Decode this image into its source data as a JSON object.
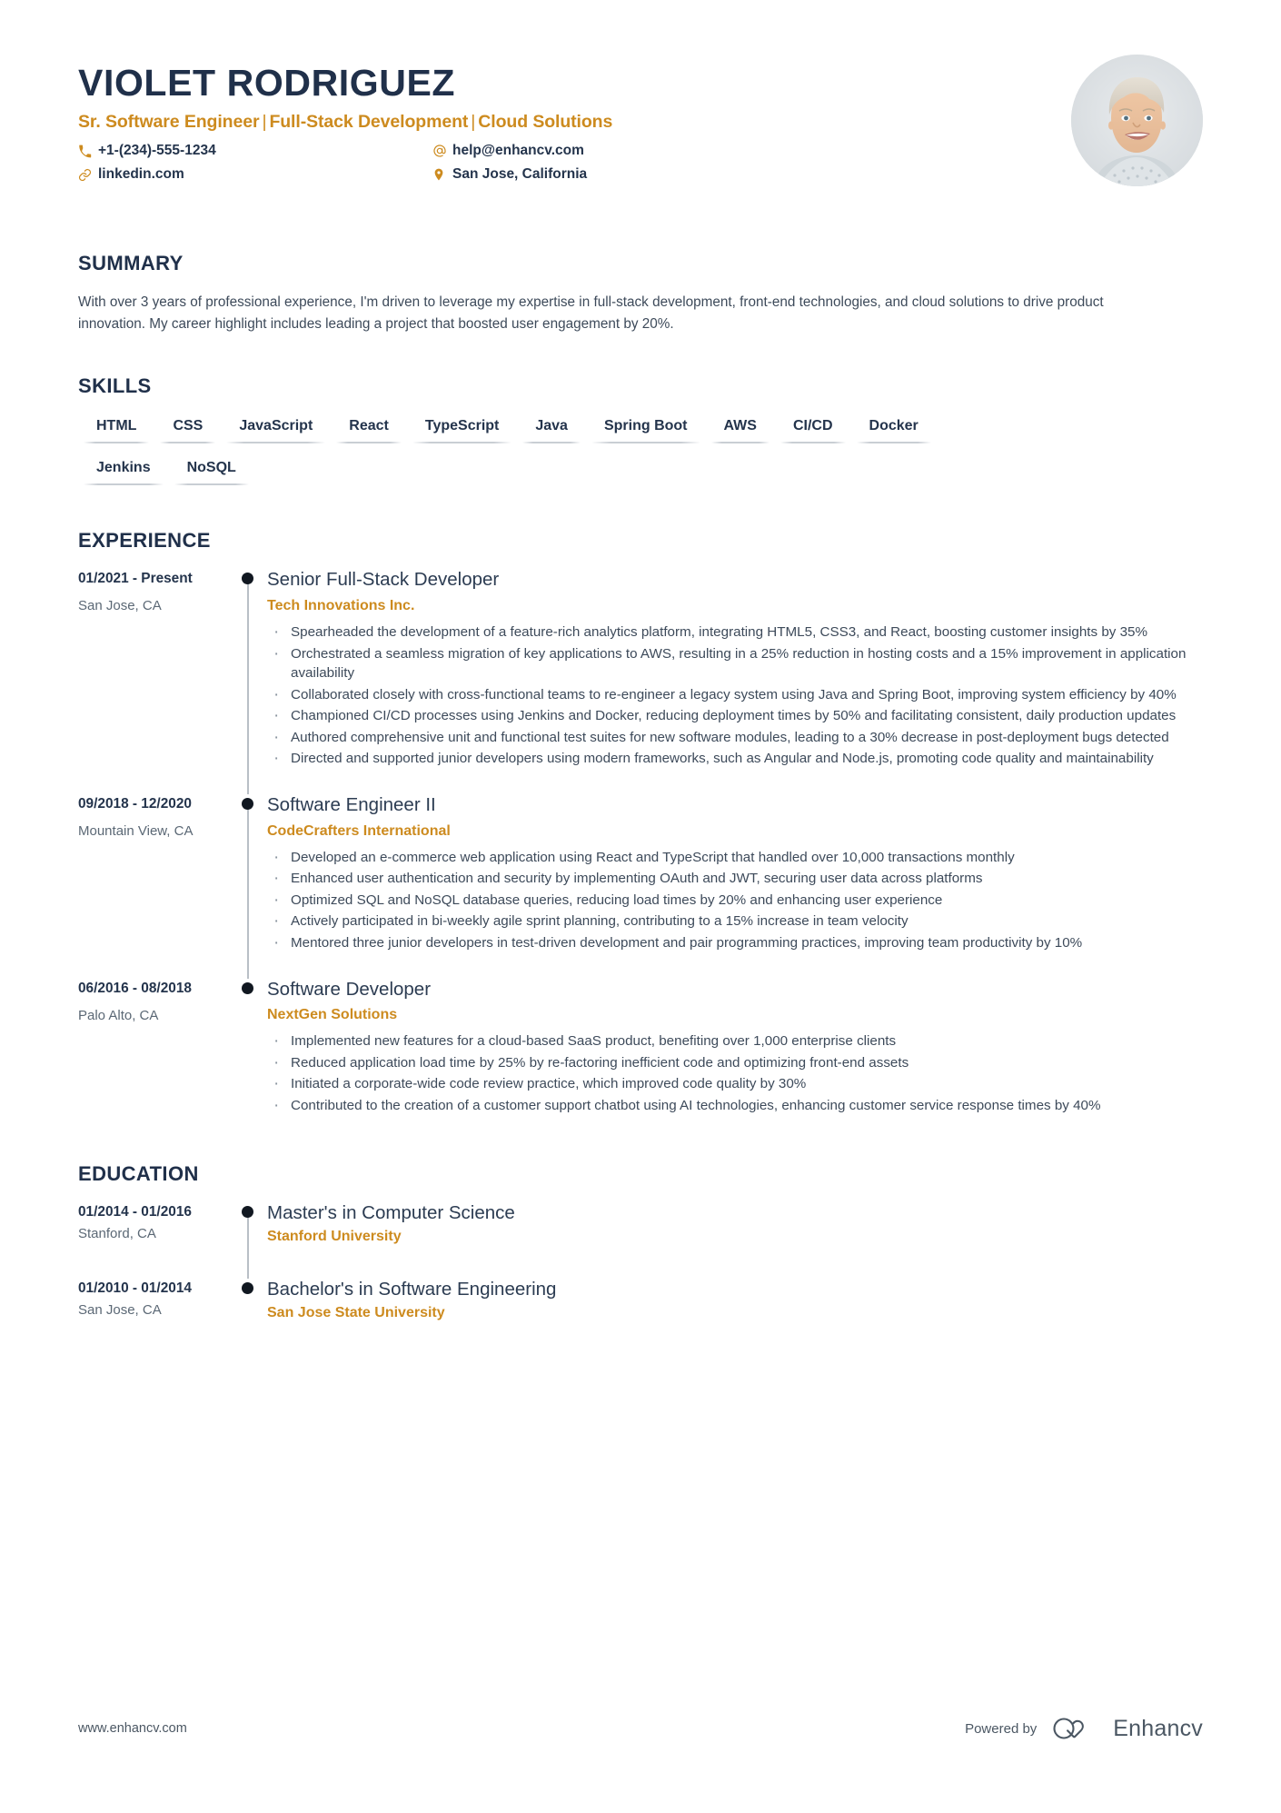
{
  "header": {
    "name": "VIOLET RODRIGUEZ",
    "headline_parts": [
      "Sr. Software Engineer",
      "Full-Stack Development",
      "Cloud Solutions"
    ],
    "headline": "Sr. Software Engineer | Full-Stack Development | Cloud Solutions",
    "contacts": [
      {
        "icon": "phone-icon",
        "value": "+1-(234)-555-1234"
      },
      {
        "icon": "at-icon",
        "value": "help@enhancv.com"
      },
      {
        "icon": "link-icon",
        "value": "linkedin.com"
      },
      {
        "icon": "location-pin-icon",
        "value": "San Jose, California"
      }
    ],
    "photo_alt": "portrait-photo"
  },
  "summary": {
    "title": "SUMMARY",
    "text": "With over 3 years of professional experience, I'm driven to leverage my expertise in full-stack development, front-end technologies, and cloud solutions to drive product innovation. My career highlight includes leading a project that boosted user engagement by 20%."
  },
  "skills": {
    "title": "SKILLS",
    "rows": [
      [
        "HTML",
        "CSS",
        "JavaScript",
        "React",
        "TypeScript",
        "Java",
        "Spring Boot",
        "AWS",
        "CI/CD",
        "Docker"
      ],
      [
        "Jenkins",
        "NoSQL"
      ]
    ]
  },
  "experience": {
    "title": "EXPERIENCE",
    "entries": [
      {
        "date": "01/2021 - Present",
        "location": "San Jose, CA",
        "title": "Senior Full-Stack Developer",
        "company": "Tech Innovations Inc.",
        "bullets": [
          "Spearheaded the development of a feature-rich analytics platform, integrating HTML5, CSS3, and React, boosting customer insights by 35%",
          "Orchestrated a seamless migration of key applications to AWS, resulting in a 25% reduction in hosting costs and a 15% improvement in application availability",
          "Collaborated closely with cross-functional teams to re-engineer a legacy system using Java and Spring Boot, improving system efficiency by 40%",
          "Championed CI/CD processes using Jenkins and Docker, reducing deployment times by 50% and facilitating consistent, daily production updates",
          "Authored comprehensive unit and functional test suites for new software modules, leading to a 30% decrease in post-deployment bugs detected",
          "Directed and supported junior developers using modern frameworks, such as Angular and Node.js, promoting code quality and maintainability"
        ]
      },
      {
        "date": "09/2018 - 12/2020",
        "location": "Mountain View, CA",
        "title": "Software Engineer II",
        "company": "CodeCrafters International",
        "bullets": [
          "Developed an e-commerce web application using React and TypeScript that handled over 10,000 transactions monthly",
          "Enhanced user authentication and security by implementing OAuth and JWT, securing user data across platforms",
          "Optimized SQL and NoSQL database queries, reducing load times by 20% and enhancing user experience",
          "Actively participated in bi-weekly agile sprint planning, contributing to a 15% increase in team velocity",
          "Mentored three junior developers in test-driven development and pair programming practices, improving team productivity by 10%"
        ]
      },
      {
        "date": "06/2016 - 08/2018",
        "location": "Palo Alto, CA",
        "title": "Software Developer",
        "company": "NextGen Solutions",
        "bullets": [
          "Implemented new features for a cloud-based SaaS product, benefiting over 1,000 enterprise clients",
          "Reduced application load time by 25% by re-factoring inefficient code and optimizing front-end assets",
          "Initiated a corporate-wide code review practice, which improved code quality by 30%",
          "Contributed to the creation of a customer support chatbot using AI technologies, enhancing customer service response times by 40%"
        ]
      }
    ]
  },
  "education": {
    "title": "EDUCATION",
    "entries": [
      {
        "date": "01/2014 - 01/2016",
        "location": "Stanford, CA",
        "title": "Master's in Computer Science",
        "company": "Stanford University"
      },
      {
        "date": "01/2010 - 01/2014",
        "location": "San Jose, CA",
        "title": "Bachelor's in Software Engineering",
        "company": "San Jose State University"
      }
    ]
  },
  "footer": {
    "url": "www.enhancv.com",
    "powered_by": "Powered by",
    "brand": "Enhancv"
  },
  "colors": {
    "accent": "#cd8b1f",
    "heading": "#20304a",
    "body": "#3d4a5a",
    "muted": "#5b6875",
    "rule": "#c9ced4"
  }
}
